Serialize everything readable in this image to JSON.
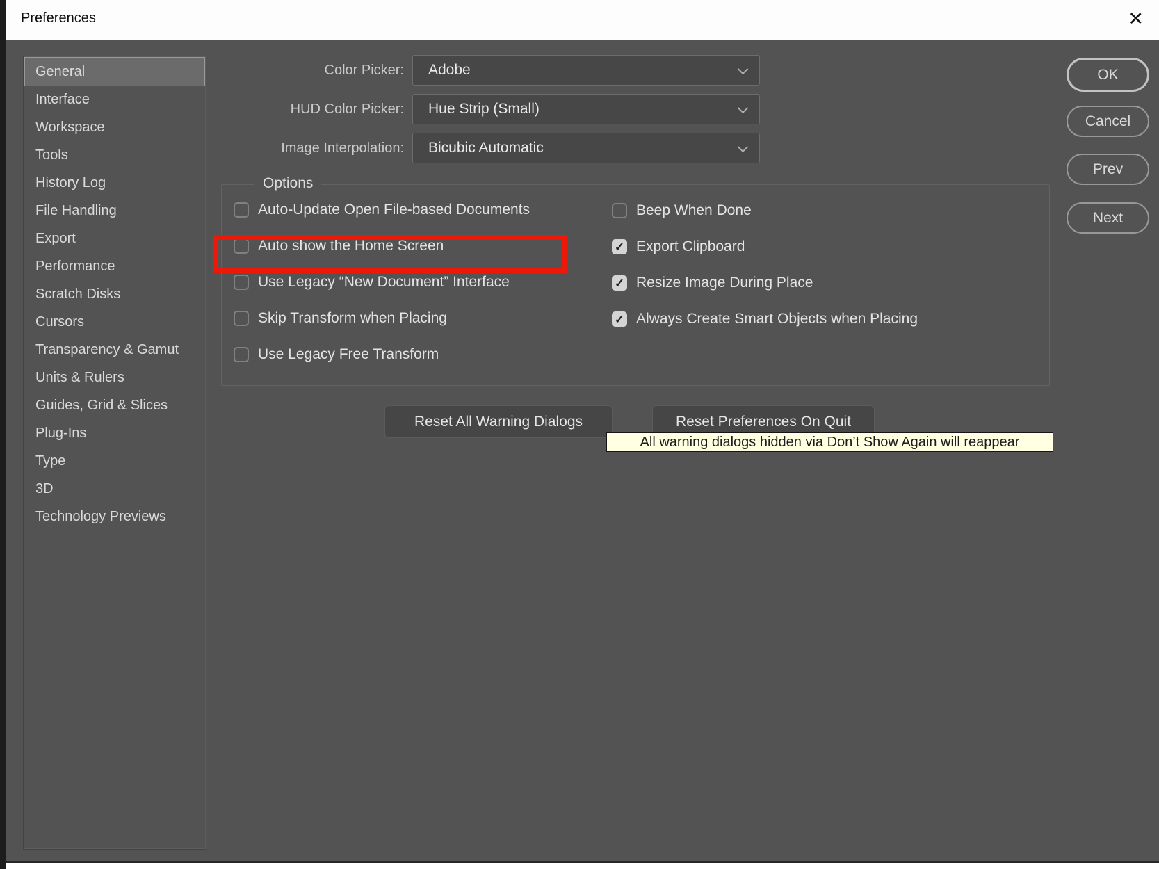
{
  "window": {
    "title": "Preferences"
  },
  "icons": {
    "close": "✕",
    "check": "✓",
    "chevron": "css-chevron-down"
  },
  "sidebar": {
    "items": [
      {
        "label": "General",
        "selected": true
      },
      {
        "label": "Interface",
        "selected": false
      },
      {
        "label": "Workspace",
        "selected": false
      },
      {
        "label": "Tools",
        "selected": false
      },
      {
        "label": "History Log",
        "selected": false
      },
      {
        "label": "File Handling",
        "selected": false
      },
      {
        "label": "Export",
        "selected": false
      },
      {
        "label": "Performance",
        "selected": false
      },
      {
        "label": "Scratch Disks",
        "selected": false
      },
      {
        "label": "Cursors",
        "selected": false
      },
      {
        "label": "Transparency & Gamut",
        "selected": false
      },
      {
        "label": "Units & Rulers",
        "selected": false
      },
      {
        "label": "Guides, Grid & Slices",
        "selected": false
      },
      {
        "label": "Plug-Ins",
        "selected": false
      },
      {
        "label": "Type",
        "selected": false
      },
      {
        "label": "3D",
        "selected": false
      },
      {
        "label": "Technology Previews",
        "selected": false
      }
    ]
  },
  "fields": {
    "rows": [
      {
        "label": "Color Picker:",
        "value": "Adobe"
      },
      {
        "label": "HUD Color Picker:",
        "value": "Hue Strip (Small)"
      },
      {
        "label": "Image Interpolation:",
        "value": "Bicubic Automatic"
      }
    ]
  },
  "options": {
    "group_label": "Options",
    "left": [
      {
        "label": "Auto-Update Open File-based Documents",
        "checked": false,
        "highlighted": false
      },
      {
        "label": "Auto show the Home Screen",
        "checked": false,
        "highlighted": true
      },
      {
        "label": "Use Legacy “New Document” Interface",
        "checked": false,
        "highlighted": false
      },
      {
        "label": "Skip Transform when Placing",
        "checked": false,
        "highlighted": false
      },
      {
        "label": "Use Legacy Free Transform",
        "checked": false,
        "highlighted": false
      }
    ],
    "right": [
      {
        "label": "Beep When Done",
        "checked": false
      },
      {
        "label": "Export Clipboard",
        "checked": true
      },
      {
        "label": "Resize Image During Place",
        "checked": true
      },
      {
        "label": "Always Create Smart Objects when Placing",
        "checked": true
      }
    ]
  },
  "reset_buttons": {
    "warning_dialogs": "Reset All Warning Dialogs",
    "preferences_on_quit": "Reset Preferences On Quit"
  },
  "tooltip": {
    "text": "All warning dialogs hidden via Don’t Show Again will reappear"
  },
  "action_buttons": {
    "ok": "OK",
    "cancel": "Cancel",
    "prev": "Prev",
    "next": "Next"
  },
  "colors": {
    "dialog_bg": "#535353",
    "highlight_red": "#ec1809",
    "tooltip_bg": "#ffffe1",
    "titlebar_bg": "#fdfdfd",
    "checkbox_checked_bg": "#d4d4d4"
  }
}
